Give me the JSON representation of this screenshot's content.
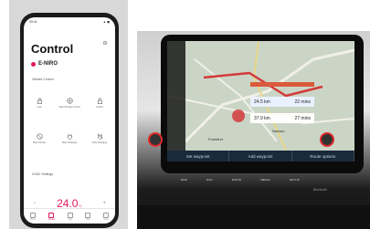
{
  "phone": {
    "status": {
      "time": "09:41",
      "icons": "▲ ◼"
    },
    "title": "Control",
    "vehicle": "E-NIRO",
    "section_vehicle_control": "Vehicle Control",
    "controls": [
      {
        "label": "Lock",
        "icon": "lock-icon"
      },
      {
        "label": "Start Climate Control",
        "icon": "fan-icon"
      },
      {
        "label": "Unlock",
        "icon": "unlock-icon"
      },
      {
        "label": "Stop Climate",
        "icon": "fan-off-icon"
      },
      {
        "label": "Start Charging",
        "icon": "plug-icon"
      },
      {
        "label": "Stop Charging",
        "icon": "plug-off-icon"
      }
    ],
    "section_hvac": "HVAC Settings",
    "temp_minus": "−",
    "temp_value": "24.0",
    "temp_unit": "°C",
    "temp_plus": "+",
    "temp_level": 0.55,
    "tabs": [
      "Home",
      "Control",
      "Trips",
      "Map",
      "More"
    ],
    "accent": "#e0185f"
  },
  "car": {
    "routes": [
      {
        "distance": "24.5 km",
        "time": "22 mins"
      },
      {
        "distance": "37.9 km",
        "time": "27 mins"
      }
    ],
    "map_labels": [
      "Frankfurt",
      "Nassau"
    ],
    "softkeys": [
      "Set waypoint",
      "Add waypoint",
      "Route options"
    ],
    "hardkeys": [
      "MAP",
      "NAV",
      "RADIO",
      "MEDIA",
      "SETUP"
    ],
    "brand": "Bluetooth",
    "accent": "#e02a2a"
  }
}
